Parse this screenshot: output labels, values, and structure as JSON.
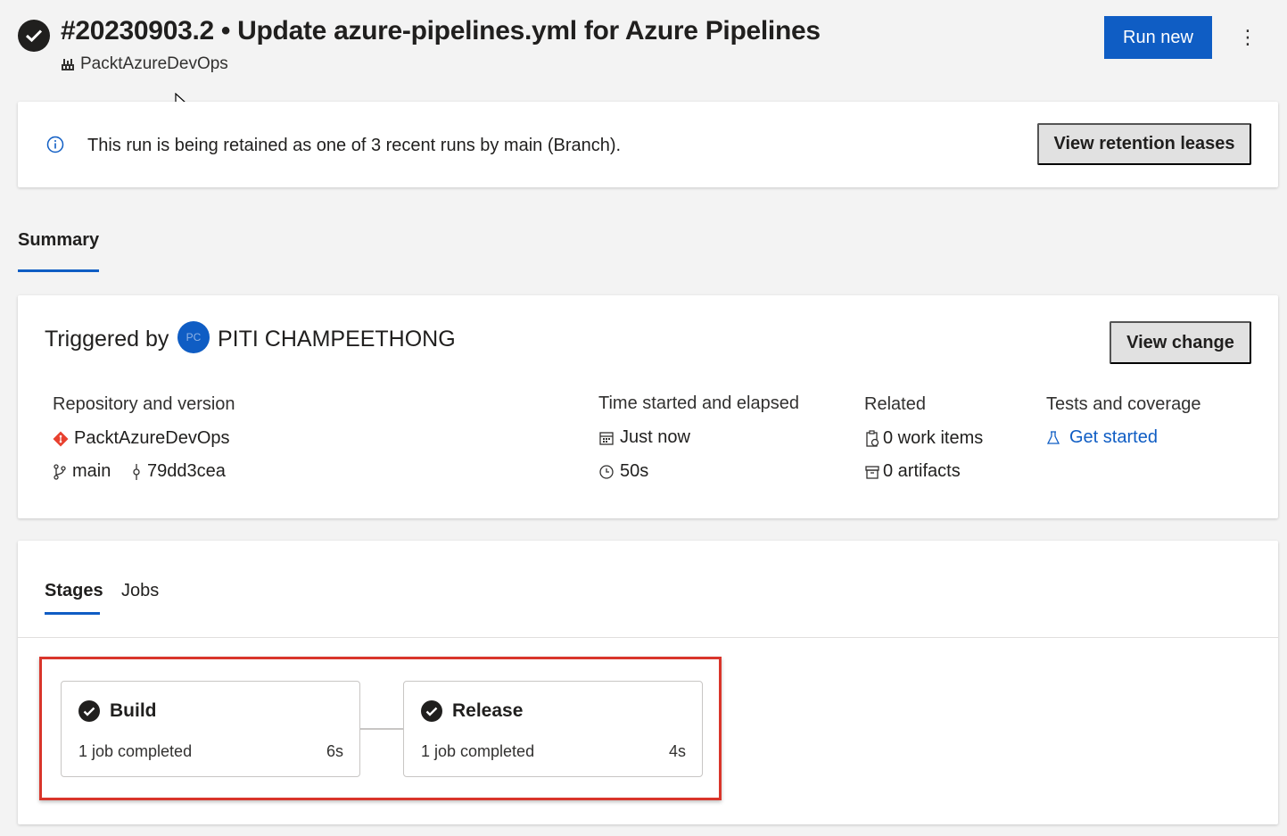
{
  "header": {
    "title": "#20230903.2 • Update azure-pipelines.yml for Azure Pipelines",
    "project": "PacktAzureDevOps",
    "run_new_label": "Run new",
    "more_label": "⋮"
  },
  "banner": {
    "message": "This run is being retained as one of 3 recent runs by main (Branch).",
    "button_label": "View retention leases"
  },
  "tabs": {
    "summary": "Summary"
  },
  "summary": {
    "triggered_by_label": "Triggered by",
    "avatar_initials": "PC",
    "user_name": "PITI CHAMPEETHONG",
    "view_change_label": "View change",
    "repository": {
      "heading": "Repository and version",
      "repo_name": "PacktAzureDevOps",
      "branch": "main",
      "commit": "79dd3cea"
    },
    "time": {
      "heading": "Time started and elapsed",
      "started": "Just now",
      "elapsed": "50s"
    },
    "related": {
      "heading": "Related",
      "work_items": "0 work items",
      "artifacts": "0 artifacts"
    },
    "tests": {
      "heading": "Tests and coverage",
      "link": "Get started"
    }
  },
  "stages_panel": {
    "tabs": [
      "Stages",
      "Jobs"
    ],
    "stages": [
      {
        "name": "Build",
        "description": "1 job completed",
        "duration": "6s"
      },
      {
        "name": "Release",
        "description": "1 job completed",
        "duration": "4s"
      }
    ]
  },
  "colors": {
    "accent": "#0f5dc4",
    "highlight_border": "#d9352b",
    "repo_icon": "#e8412f"
  }
}
